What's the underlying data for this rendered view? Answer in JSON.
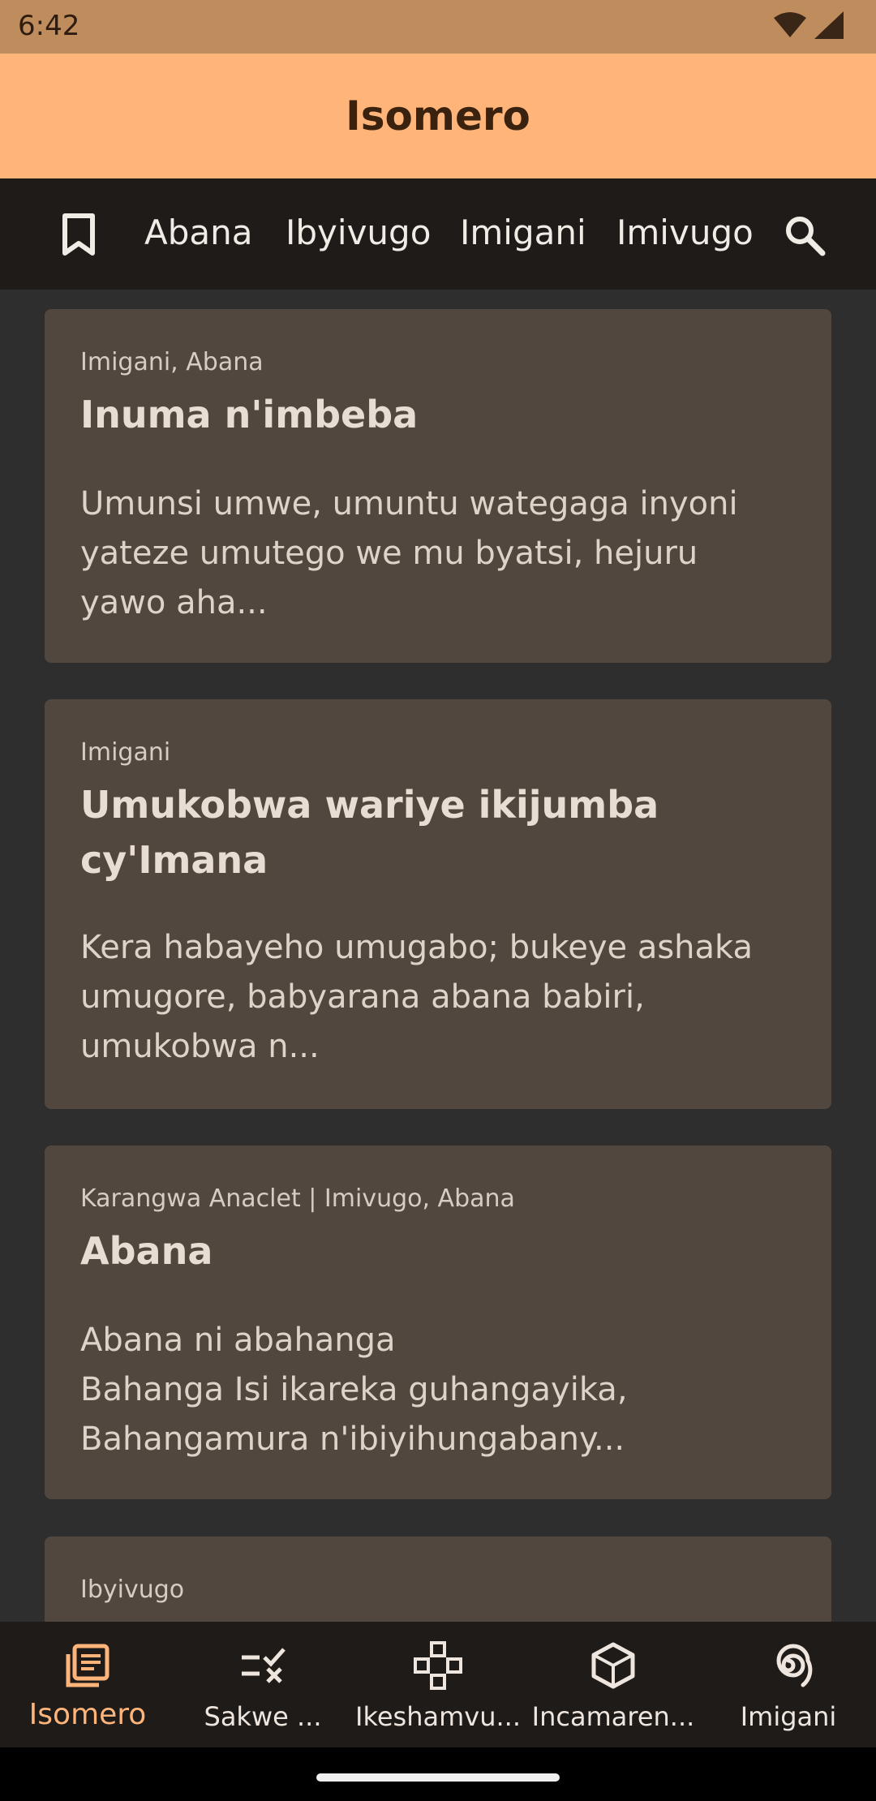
{
  "status_bar": {
    "time": "6:42"
  },
  "app_bar": {
    "title": "Isomero"
  },
  "categories": {
    "items": [
      "Abana",
      "Ibyivugo",
      "Imigani",
      "Imivugo"
    ]
  },
  "cards": [
    {
      "meta": "Imigani, Abana",
      "title": "Inuma n'imbeba",
      "excerpt": "Umunsi umwe, umuntu wategaga inyoni\nyateze umutego we mu byatsi, hejuru\nyawo aha..."
    },
    {
      "meta": "Imigani",
      "title": "Umukobwa wariye ikijumba cy'Imana",
      "excerpt": "Kera habayeho umugabo; bukeye ashaka\numugore, babyarana abana babiri,\numukobwa n..."
    },
    {
      "meta": "Karangwa Anaclet | Imivugo, Abana",
      "title": "Abana",
      "excerpt": "Abana ni abahanga\nBahanga Isi ikareka guhangayika,\nBahangamura n'ibiyihungabany..."
    },
    {
      "meta": "Ibyivugo",
      "title": "",
      "excerpt": ""
    }
  ],
  "bottom_nav": {
    "items": [
      {
        "label": "Isomero",
        "icon": "library-icon",
        "active": true
      },
      {
        "label": "Sakwe ...",
        "icon": "quiz-icon",
        "active": false
      },
      {
        "label": "Ikeshamvu...",
        "icon": "game-icon",
        "active": false
      },
      {
        "label": "Incamaren...",
        "icon": "cube-icon",
        "active": false
      },
      {
        "label": "Imigani",
        "icon": "spiral-icon",
        "active": false
      }
    ]
  },
  "colors": {
    "app_bar": "#ffb47a",
    "status_bar": "#bf8c5e",
    "nav_dark": "#1f1b18",
    "card": "#52473f",
    "background": "#2e2e2e",
    "accent": "#ffb47a"
  }
}
